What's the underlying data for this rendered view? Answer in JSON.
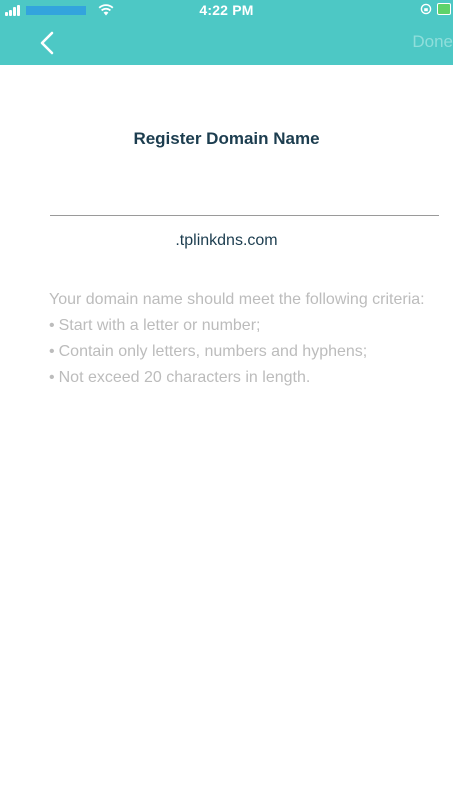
{
  "status_bar": {
    "time": "4:22 PM"
  },
  "nav": {
    "back_icon": "chevron-left-icon",
    "done_label": "Done"
  },
  "register": {
    "title": "Register Domain Name",
    "input_value": "",
    "suffix": ".tplinkdns.com"
  },
  "criteria": {
    "intro": "Your domain name should meet the following criteria:",
    "items": [
      "Start with a letter or number;",
      "Contain only letters, numbers and hyphens;",
      "Not exceed 20 characters in length."
    ],
    "bullet": "•"
  },
  "colors": {
    "accent": "#4dc8c5",
    "title_text": "#1c3d4f",
    "hint_text": "#bcbcbc",
    "done_disabled": "#8fdedb"
  }
}
